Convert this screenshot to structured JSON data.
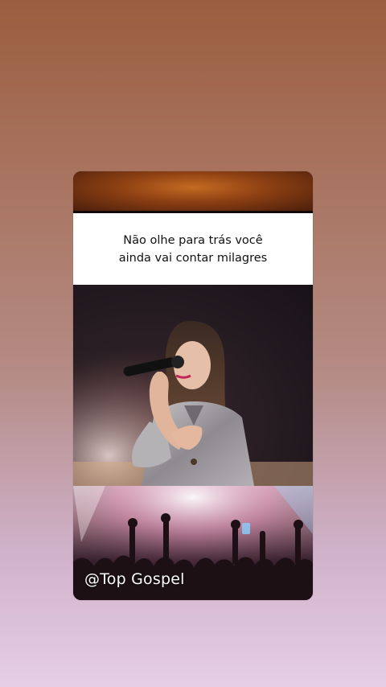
{
  "story": {
    "caption_line1": "Não olhe para trás você",
    "caption_line2": "ainda vai contar milagres",
    "watermark": "@Top Gospel"
  },
  "colors": {
    "background_top": "#9a5e3f",
    "background_bottom": "#e6cfe6",
    "caption_bg": "#ffffff",
    "caption_text": "#111111",
    "accent_orange": "#c56a22"
  },
  "images": {
    "photo": "singer-photo",
    "crowd": "concert-crowd-photo"
  }
}
